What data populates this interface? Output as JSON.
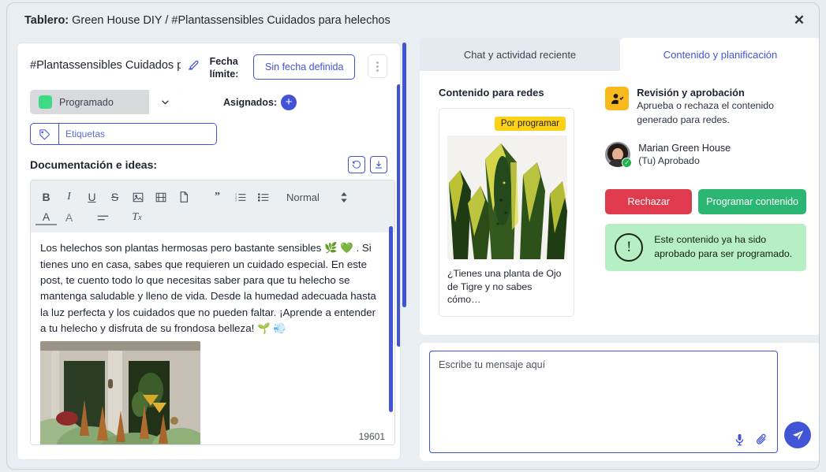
{
  "header": {
    "label": "Tablero:",
    "breadcrumb": "Green House DIY / #Plantassensibles Cuidados para helechos",
    "close_icon": "close-icon"
  },
  "card": {
    "title": "#Plantassensibles Cuidados pa…",
    "edit_icon": "edit-pencil-icon",
    "due_date_label": "Fecha límite:",
    "due_date_value": "Sin fecha definida",
    "kebab_icon": "more-vertical-icon",
    "status": {
      "value": "Programado",
      "color": "#3ddc84",
      "caret_icon": "chevron-down-icon"
    },
    "assignees_label": "Asignados:",
    "assignees_add_icon": "plus-icon",
    "tags_icon": "tag-icon",
    "tags_placeholder": "Etiquetas"
  },
  "documentation": {
    "label": "Documentación e ideas:",
    "history_icon": "history-revert-icon",
    "download_icon": "download-icon",
    "toolbar": {
      "row1": [
        {
          "name": "bold-icon",
          "glyph": "B"
        },
        {
          "name": "italic-icon",
          "glyph": "I"
        },
        {
          "name": "underline-icon",
          "glyph": "U"
        },
        {
          "name": "strikethrough-icon",
          "glyph": "S"
        },
        {
          "name": "image-icon",
          "glyph": "▣"
        },
        {
          "name": "video-icon",
          "glyph": "▤"
        },
        {
          "name": "file-icon",
          "glyph": "🗋"
        },
        {
          "name": "blockquote-icon",
          "glyph": "❞"
        },
        {
          "name": "ordered-list-icon",
          "glyph": "≔"
        },
        {
          "name": "bullet-list-icon",
          "glyph": "☰"
        }
      ],
      "row2": [
        {
          "name": "font-color-icon",
          "glyph": "A"
        },
        {
          "name": "highlight-color-icon",
          "glyph": "A"
        },
        {
          "name": "align-icon",
          "glyph": "≡"
        },
        {
          "name": "clear-format-icon",
          "glyph": "Tx"
        }
      ],
      "format_select": "Normal",
      "format_caret_icon": "chevron-updown-icon"
    },
    "text": "Los helechos son plantas hermosas pero bastante sensibles 🌿 💚 . Si tienes uno en casa, sabes que requieren un cuidado especial. En este post, te cuento todo lo que necesitas saber para que tu helecho se mantenga saludable y lleno de vida. Desde la humedad adecuada hasta la luz perfecta y los cuidados que no pueden faltar. ¡Aprende a entender a tu helecho y disfruta de su frondosa belleza! 🌱 💨",
    "char_count": "19601"
  },
  "right": {
    "tabs": [
      {
        "label": "Chat y actividad reciente",
        "active": false
      },
      {
        "label": "Contenido y planificación",
        "active": true
      }
    ],
    "content_section": {
      "title": "Contenido para redes",
      "badge": "Por programar",
      "caption": "¿Tienes una planta de Ojo de Tigre y no sabes cómo…",
      "photo_alt": "snake-plant-photo"
    },
    "review": {
      "icon": "user-check-icon",
      "title": "Revisión y aprobación",
      "subtitle": "Aprueba o rechaza el contenido generado para redes.",
      "user_name": "Marian Green House",
      "user_status": "(Tu) Aprobado",
      "verified_icon": "check-badge-icon",
      "reject_button": "Rechazar",
      "schedule_button": "Programar contenido",
      "notice_icon": "exclamation-circle-icon",
      "notice_text": "Este contenido ya ha sido aprobado para ser programado.",
      "colors": {
        "reject": "#e03a4e",
        "schedule": "#2bb673",
        "notice_bg": "#b6efc3",
        "icon_bg": "#f7b91c"
      }
    },
    "compose": {
      "placeholder": "Escribe tu mensaje aquí",
      "mic_icon": "microphone-icon",
      "attach_icon": "paperclip-icon",
      "send_icon": "send-plane-icon"
    }
  }
}
